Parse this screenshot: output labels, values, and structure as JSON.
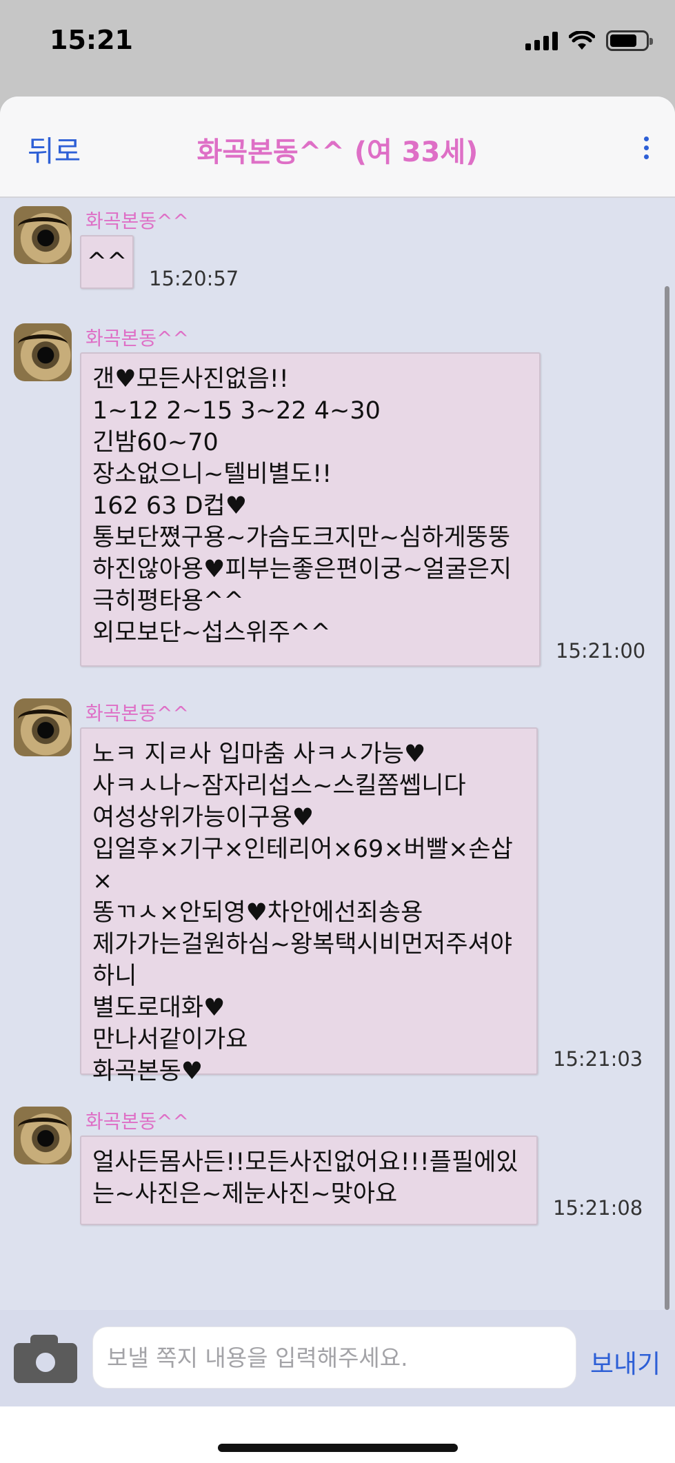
{
  "status_bar": {
    "time": "15:21"
  },
  "header": {
    "back_label": "뒤로",
    "title": "화곡본동^^ (여 33세)"
  },
  "messages": [
    {
      "sender": "화곡본동^^",
      "text": "^^",
      "time": "15:20:57"
    },
    {
      "sender": "화곡본동^^",
      "text": "갠♥모든사진없음!!\n1~12 2~15 3~22 4~30\n긴밤60~70\n장소없으니~텔비별도!!\n162 63 D컵♥\n통보단쪘구용~가슴도크지만~심하게뚱뚱\n하진않아용♥피부는좋은편이궁~얼굴은지\n극히평타용^^\n외모보단~섭스위주^^",
      "time": "15:21:00"
    },
    {
      "sender": "화곡본동^^",
      "text": "노ㅋ 지ㄹ사 입마춤 사ㅋㅅ가능♥\n사ㅋㅅ나~잠자리섭스~스킬쫌쎕니다\n여성상위가능이구용♥\n입얼후×기구×인테리어×69×버빨×손삽×\n똥ㄲㅅ×안되영♥차안에선죄송용\n제가가는걸원하심~왕복택시비먼저주셔야\n하니\n별도로대화♥\n만나서같이가요\n화곡본동♥",
      "time": "15:21:03"
    },
    {
      "sender": "화곡본동^^",
      "text": "얼사든몸사든!!모든사진없어요!!!플필에있\n는~사진은~제눈사진~맞아요",
      "time": "15:21:08"
    }
  ],
  "composer": {
    "placeholder": "보낼 쪽지 내용을 입력해주세요.",
    "send_label": "보내기"
  },
  "colors": {
    "accent": "#2d5fd6",
    "sender_pink": "#de6fc6",
    "bubble": "#e8d8e6",
    "background": "#dde1ee"
  }
}
